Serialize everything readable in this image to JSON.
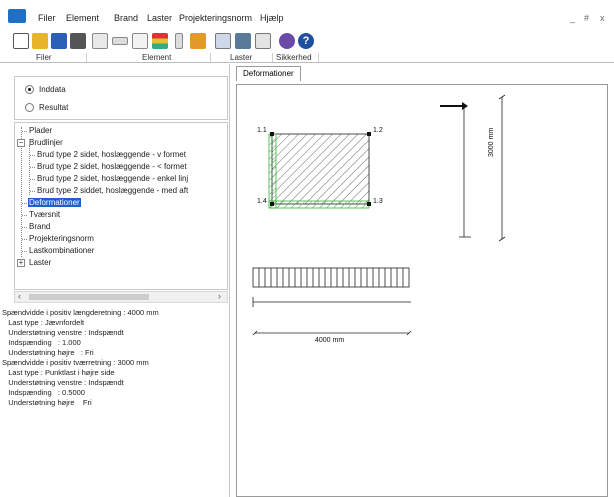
{
  "menu": [
    "Filer",
    "Element",
    "Brand",
    "Laster",
    "Projekteringsnorm",
    "Hjælp"
  ],
  "window_controls": [
    "_",
    "#",
    "x"
  ],
  "toolbar": {
    "icons": [
      "new-file-icon",
      "open-folder-icon",
      "save-icon",
      "print-icon",
      "plate-icon",
      "beam-icon",
      "comment-icon",
      "chart-icon",
      "column-icon",
      "panel-icon",
      "load-icon",
      "monitor-icon",
      "grid-icon",
      "safety-icon",
      "help-icon"
    ],
    "group_labels": [
      "Filer",
      "Element",
      "Laster",
      "Sikkerhed"
    ]
  },
  "mode": {
    "options": [
      "Inddata",
      "Resultat"
    ],
    "selected": "Inddata"
  },
  "tree": {
    "items": [
      "Plader",
      "Brudlinjer",
      "Brud type 2 sidet, hoslæggende - v formet",
      "Brud type 2 sidet, hoslæggende - < formet",
      "Brud type 2 sidet, hoslæggende - enkel linj",
      "Brud type 2 siddet, hoslæggende - med aft",
      "Deformationer",
      "Tværsnit",
      "Brand",
      "Projekteringsnorm",
      "Lastkombinationer",
      "Laster"
    ],
    "selected": "Deformationer"
  },
  "info_lines": [
    "Spændvidde i positiv længderetning : 4000 mm",
    "   Last type : Jævnfordelt",
    "   Understøtning venstre : Indspændt",
    "   Indspænding   : 1.000",
    "   Understøtning højre   : Fri",
    "Spændvidde i positiv tværretning : 3000 mm",
    "   Last type : Punktlast i højre side",
    "   Understøtning venstre : Indspændt",
    "   Indspænding   : 0.5000",
    "   Understøtning højre    Fri"
  ],
  "tab_label": "Deformationer",
  "drawing": {
    "nodes": [
      "1.1",
      "1.2",
      "1.3",
      "1.4"
    ],
    "dim_vertical": "3000 mm",
    "dim_horizontal": "4000 mm"
  },
  "colors": {
    "selection": "#1f5fd0",
    "support_hatch": "#3cb43c",
    "accent": "#1f6fc4"
  }
}
